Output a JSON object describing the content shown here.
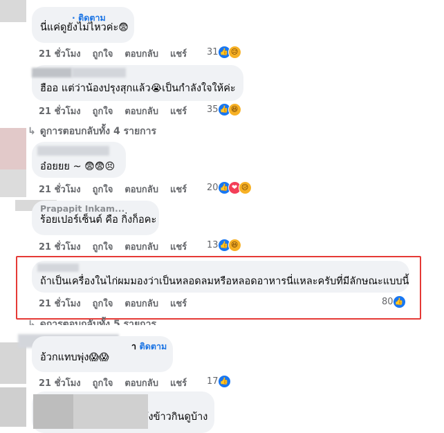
{
  "follow_label": "· ติดตาม",
  "follow_label2": "ติดตาม",
  "actions": {
    "time": "21 ชั่วโมง",
    "like": "ถูกใจ",
    "reply": "ตอบกลับ",
    "share": "แชร์"
  },
  "comments": [
    {
      "text": "นี่แค่ดูยังไม่ไหวค่ะ",
      "emoji": "😨",
      "reactions": "31"
    },
    {
      "text": "ฮืออ แต่ว่าน้องปรุงสุกแล้ว",
      "emoji": "😭",
      "text2": "เป็นกำลังใจให้ค่ะ",
      "reactions": "35"
    },
    {
      "text": "อ๋อยยย ~",
      "emoji": "😨😨😣",
      "reactions": "20"
    },
    {
      "name": "Prapapit Inkam...",
      "text": "ร้อยเปอร์เซ็นต์ คือ กิ่งก็อคะ",
      "reactions": "13"
    },
    {
      "text": "ถ้าเป็นเครื่องในไก่ผมมองว่าเป็นหลอดลมหรือหลอดอาหารนี่แหละครับที่มีลักษณะแบบนี้",
      "reactions": "80"
    },
    {
      "name": "า",
      "text": "อ้วกแทบพุ่ง",
      "emoji": "😱😱",
      "reactions": "17"
    },
    {
      "text": "ยังข้าวกินดูบ้าง"
    }
  ],
  "replies": [
    {
      "label": "ดูการตอบกลับทั้ง 4 รายการ"
    },
    {
      "label": "ดูการตอบกลับทั้ง 5 รายการ"
    }
  ],
  "colors": {
    "accent": "#1877f2",
    "highlight": "#e53935",
    "bubble": "#f0f2f5"
  }
}
